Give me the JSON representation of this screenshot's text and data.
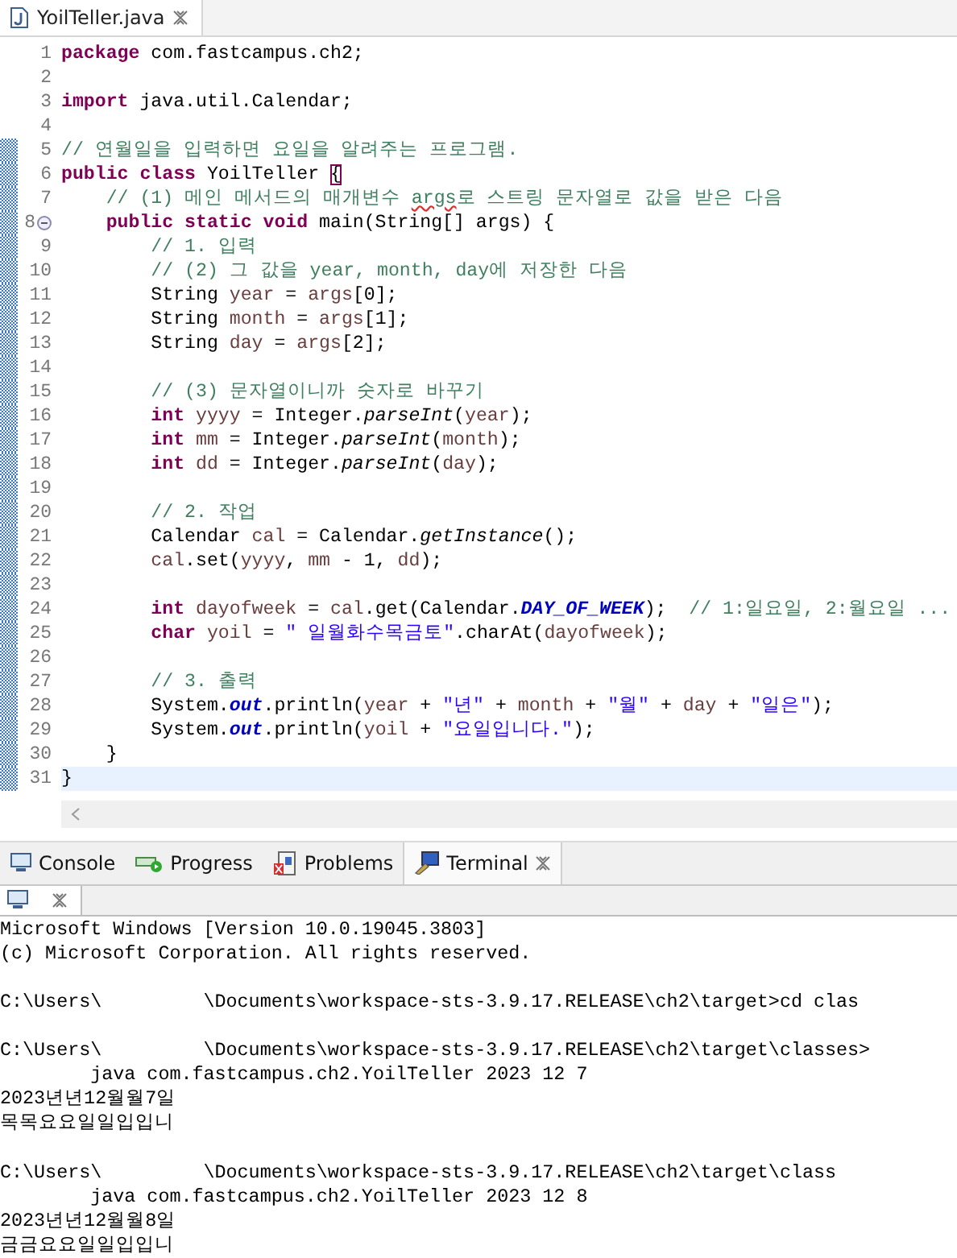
{
  "editor": {
    "tab": {
      "label": "YoilTeller.java",
      "selected": true
    },
    "lines": [
      {
        "number": "1",
        "changed": false,
        "tokens": [
          {
            "kind": "kw",
            "text": "package "
          },
          {
            "kind": "plain",
            "text": "com.fastcampus.ch2;"
          }
        ]
      },
      {
        "number": "2",
        "changed": false
      },
      {
        "number": "3",
        "changed": false,
        "tokens": [
          {
            "kind": "kw",
            "text": "import "
          },
          {
            "kind": "plain",
            "text": "java.util.Calendar;"
          }
        ]
      },
      {
        "number": "4",
        "changed": false
      },
      {
        "number": "5",
        "changed": true,
        "tokens": [
          {
            "kind": "comment",
            "text": "// 연월일을 입력하면 요일을 알려주는 프로그램."
          }
        ]
      },
      {
        "number": "6",
        "changed": true,
        "tokens": [
          {
            "kind": "kw",
            "text": "public "
          },
          {
            "kind": "kw",
            "text": "class"
          },
          {
            "kind": "plain",
            "text": " YoilTeller "
          },
          {
            "kind": "bracket",
            "text": "{"
          }
        ]
      },
      {
        "number": "7",
        "changed": true,
        "tokens": [
          {
            "kind": "comment",
            "text": "    // (1) 메인 메서드의 매개변수 "
          },
          {
            "kind": "warn",
            "text": "args"
          },
          {
            "kind": "comment",
            "text": "로 스트링 문자열로 값을 받은 다음"
          }
        ]
      },
      {
        "number": "8",
        "changed": true,
        "fold_expanded": true,
        "tokens": [
          {
            "kind": "kw",
            "text": "    public static void"
          },
          {
            "kind": "plain",
            "text": " main(String[] args) {"
          }
        ]
      },
      {
        "number": "9",
        "changed": true,
        "tokens": [
          {
            "kind": "comment",
            "text": "        // 1. 입력"
          }
        ]
      },
      {
        "number": "10",
        "changed": true,
        "tokens": [
          {
            "kind": "comment",
            "text": "        // (2) 그 값을 year, month, day에 저장한 다음"
          }
        ]
      },
      {
        "number": "11",
        "changed": true,
        "tokens": [
          {
            "kind": "plain",
            "text": "        String "
          },
          {
            "kind": "var",
            "text": "year"
          },
          {
            "kind": "plain",
            "text": " = "
          },
          {
            "kind": "var",
            "text": "args"
          },
          {
            "kind": "plain",
            "text": "[0];"
          }
        ]
      },
      {
        "number": "12",
        "changed": true,
        "tokens": [
          {
            "kind": "plain",
            "text": "        String "
          },
          {
            "kind": "var",
            "text": "month"
          },
          {
            "kind": "plain",
            "text": " = "
          },
          {
            "kind": "var",
            "text": "args"
          },
          {
            "kind": "plain",
            "text": "[1];"
          }
        ]
      },
      {
        "number": "13",
        "changed": true,
        "tokens": [
          {
            "kind": "plain",
            "text": "        String "
          },
          {
            "kind": "var",
            "text": "day"
          },
          {
            "kind": "plain",
            "text": " = "
          },
          {
            "kind": "var",
            "text": "args"
          },
          {
            "kind": "plain",
            "text": "[2];"
          }
        ]
      },
      {
        "number": "14",
        "changed": true
      },
      {
        "number": "15",
        "changed": true,
        "tokens": [
          {
            "kind": "comment",
            "text": "        // (3) 문자열이니까 숫자로 바꾸기"
          }
        ]
      },
      {
        "number": "16",
        "changed": true,
        "tokens": [
          {
            "kind": "kw",
            "text": "        int "
          },
          {
            "kind": "var",
            "text": "yyyy"
          },
          {
            "kind": "plain",
            "text": " = Integer."
          },
          {
            "kind": "italic",
            "text": "parseInt"
          },
          {
            "kind": "plain",
            "text": "("
          },
          {
            "kind": "var",
            "text": "year"
          },
          {
            "kind": "plain",
            "text": ");"
          }
        ]
      },
      {
        "number": "17",
        "changed": true,
        "tokens": [
          {
            "kind": "kw",
            "text": "        int "
          },
          {
            "kind": "var",
            "text": "mm"
          },
          {
            "kind": "plain",
            "text": " = Integer."
          },
          {
            "kind": "italic",
            "text": "parseInt"
          },
          {
            "kind": "plain",
            "text": "("
          },
          {
            "kind": "var",
            "text": "month"
          },
          {
            "kind": "plain",
            "text": ");"
          }
        ]
      },
      {
        "number": "18",
        "changed": true,
        "tokens": [
          {
            "kind": "kw",
            "text": "        int "
          },
          {
            "kind": "var",
            "text": "dd"
          },
          {
            "kind": "plain",
            "text": " = Integer."
          },
          {
            "kind": "italic",
            "text": "parseInt"
          },
          {
            "kind": "plain",
            "text": "("
          },
          {
            "kind": "var",
            "text": "day"
          },
          {
            "kind": "plain",
            "text": ");"
          }
        ]
      },
      {
        "number": "19",
        "changed": true
      },
      {
        "number": "20",
        "changed": true,
        "tokens": [
          {
            "kind": "comment",
            "text": "        // 2. 작업"
          }
        ]
      },
      {
        "number": "21",
        "changed": true,
        "tokens": [
          {
            "kind": "plain",
            "text": "        Calendar "
          },
          {
            "kind": "var",
            "text": "cal"
          },
          {
            "kind": "plain",
            "text": " = Calendar."
          },
          {
            "kind": "italic",
            "text": "getInstance"
          },
          {
            "kind": "plain",
            "text": "();"
          }
        ]
      },
      {
        "number": "22",
        "changed": true,
        "tokens": [
          {
            "kind": "var",
            "text": "        cal"
          },
          {
            "kind": "plain",
            "text": ".set("
          },
          {
            "kind": "var",
            "text": "yyyy"
          },
          {
            "kind": "plain",
            "text": ", "
          },
          {
            "kind": "var",
            "text": "mm"
          },
          {
            "kind": "plain",
            "text": " - 1, "
          },
          {
            "kind": "var",
            "text": "dd"
          },
          {
            "kind": "plain",
            "text": ");"
          }
        ]
      },
      {
        "number": "23",
        "changed": true
      },
      {
        "number": "24",
        "changed": true,
        "tokens": [
          {
            "kind": "kw",
            "text": "        int "
          },
          {
            "kind": "var",
            "text": "dayofweek"
          },
          {
            "kind": "plain",
            "text": " = "
          },
          {
            "kind": "var",
            "text": "cal"
          },
          {
            "kind": "plain",
            "text": ".get(Calendar."
          },
          {
            "kind": "static",
            "text": "DAY_OF_WEEK"
          },
          {
            "kind": "plain",
            "text": ");  "
          },
          {
            "kind": "comment",
            "text": "// 1:일요일, 2:월요일 ..."
          }
        ]
      },
      {
        "number": "25",
        "changed": true,
        "tokens": [
          {
            "kind": "kw",
            "text": "        char "
          },
          {
            "kind": "var",
            "text": "yoil"
          },
          {
            "kind": "plain",
            "text": " = "
          },
          {
            "kind": "str",
            "text": "\" 일월화수목금토\""
          },
          {
            "kind": "plain",
            "text": ".charAt("
          },
          {
            "kind": "var",
            "text": "dayofweek"
          },
          {
            "kind": "plain",
            "text": ");"
          }
        ]
      },
      {
        "number": "26",
        "changed": true
      },
      {
        "number": "27",
        "changed": true,
        "tokens": [
          {
            "kind": "comment",
            "text": "        // 3. 출력"
          }
        ]
      },
      {
        "number": "28",
        "changed": true,
        "tokens": [
          {
            "kind": "plain",
            "text": "        System."
          },
          {
            "kind": "static",
            "text": "out"
          },
          {
            "kind": "plain",
            "text": ".println("
          },
          {
            "kind": "var",
            "text": "year"
          },
          {
            "kind": "plain",
            "text": " + "
          },
          {
            "kind": "str",
            "text": "\"년\""
          },
          {
            "kind": "plain",
            "text": " + "
          },
          {
            "kind": "var",
            "text": "month"
          },
          {
            "kind": "plain",
            "text": " + "
          },
          {
            "kind": "str",
            "text": "\"월\""
          },
          {
            "kind": "plain",
            "text": " + "
          },
          {
            "kind": "var",
            "text": "day"
          },
          {
            "kind": "plain",
            "text": " + "
          },
          {
            "kind": "str",
            "text": "\"일은\""
          },
          {
            "kind": "plain",
            "text": ");"
          }
        ]
      },
      {
        "number": "29",
        "changed": true,
        "tokens": [
          {
            "kind": "plain",
            "text": "        System."
          },
          {
            "kind": "static",
            "text": "out"
          },
          {
            "kind": "plain",
            "text": ".println("
          },
          {
            "kind": "var",
            "text": "yoil"
          },
          {
            "kind": "plain",
            "text": " + "
          },
          {
            "kind": "str",
            "text": "\"요일입니다.\""
          },
          {
            "kind": "plain",
            "text": ");"
          }
        ]
      },
      {
        "number": "30",
        "changed": true,
        "tokens": [
          {
            "kind": "plain",
            "text": "    }"
          }
        ]
      },
      {
        "number": "31",
        "changed": true,
        "current": true,
        "tokens": [
          {
            "kind": "plain",
            "text": "}"
          }
        ]
      }
    ]
  },
  "view_tabs": [
    {
      "label": "Console",
      "kind": "console",
      "selected": false
    },
    {
      "label": "Progress",
      "kind": "progress",
      "selected": false
    },
    {
      "label": "Problems",
      "kind": "problems",
      "selected": false
    },
    {
      "label": "Terminal",
      "kind": "terminal",
      "selected": true
    }
  ],
  "terminal": {
    "blocks": [
      [
        "Microsoft Windows [Version 10.0.19045.3803]",
        "(c) Microsoft Corporation. All rights reserved."
      ],
      [
        "C:\\Users\\         \\Documents\\workspace-sts-3.9.17.RELEASE\\ch2\\target>cd clas"
      ],
      [
        "C:\\Users\\         \\Documents\\workspace-sts-3.9.17.RELEASE\\ch2\\target\\classes>",
        "        java com.fastcampus.ch2.YoilTeller 2023 12 7",
        "2023년년12월월7일",
        "목목요요일일입입니"
      ],
      [
        "C:\\Users\\         \\Documents\\workspace-sts-3.9.17.RELEASE\\ch2\\target\\class",
        "        java com.fastcampus.ch2.YoilTeller 2023 12 8",
        "2023년년12월월8일",
        "금금요요일일입입니"
      ]
    ]
  }
}
